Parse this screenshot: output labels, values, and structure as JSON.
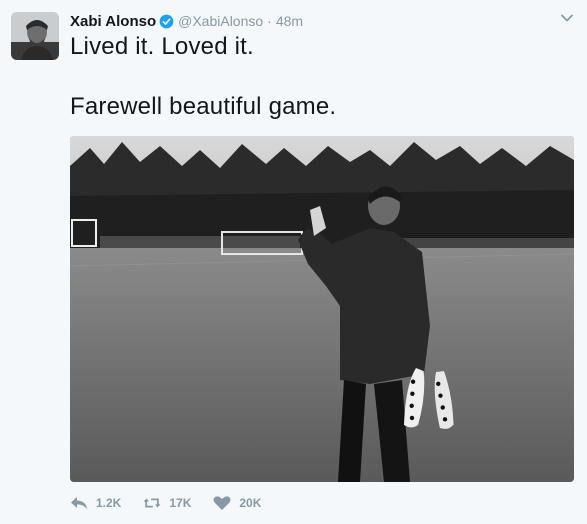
{
  "tweet": {
    "author_name": "Xabi Alonso",
    "handle": "@XabiAlonso",
    "separator": "·",
    "time": "48m",
    "text_line1": "Lived it. Loved it.",
    "text_line2": "Farewell beautiful game."
  },
  "actions": {
    "reply_count": "1.2K",
    "retweet_count": "17K",
    "like_count": "20K"
  },
  "colors": {
    "accent": "#1da1f2",
    "muted": "#8899a6",
    "background": "#f5f8fa"
  },
  "icons": [
    "verified-badge-icon",
    "caret-down-icon",
    "reply-icon",
    "retweet-icon",
    "heart-icon"
  ]
}
